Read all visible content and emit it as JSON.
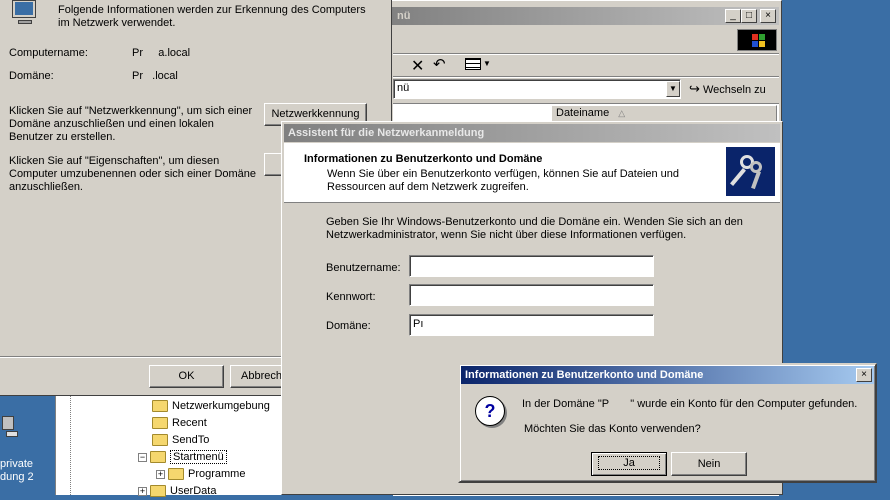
{
  "system_props": {
    "intro": "Folgende Informationen werden zur Erkennung des Computers im Netzwerk verwendet.",
    "computer_label": "Computername:",
    "computer_value": "Pr     a.local",
    "domain_label": "Domäne:",
    "domain_value": "Pr   .local",
    "network_id_text": "Klicken Sie auf \"Netzwerkkennung\", um sich einer Domäne anzuschließen und einen lokalen Benutzer zu erstellen.",
    "network_id_button": "Netzwerkkennung",
    "properties_text": "Klicken Sie auf \"Eigenschaften\", um diesen Computer umzubenennen oder sich einer Domäne anzuschließen.",
    "ok_button": "OK",
    "cancel_button": "Abbrech"
  },
  "explorer": {
    "title": "nü",
    "address_value": "nü",
    "go_button": "Wechseln zu",
    "column_filename": "Dateiname",
    "tree_items": [
      {
        "label": "Netzwerkumgebung",
        "expander": ""
      },
      {
        "label": "Recent",
        "expander": ""
      },
      {
        "label": "SendTo",
        "expander": ""
      },
      {
        "label": "Startmenü",
        "expander": "−"
      },
      {
        "label": "Programme",
        "expander": "+"
      },
      {
        "label": "UserData",
        "expander": "+"
      }
    ]
  },
  "desktop": {
    "icon_label_line1": "private",
    "icon_label_line2": "dung 2"
  },
  "wizard": {
    "title": "Assistent für die Netzwerkanmeldung",
    "header_title": "Informationen zu Benutzerkonto und Domäne",
    "header_desc": "Wenn Sie über ein Benutzerkonto verfügen, können Sie auf Dateien und Ressourcen auf dem Netzwerk zugreifen.",
    "instructions": "Geben Sie Ihr Windows-Benutzerkonto und die Domäne ein. Wenden Sie sich an den Netzwerkadministrator, wenn Sie nicht über diese Informationen verfügen.",
    "username_label": "Benutzername:",
    "username_value": "",
    "password_label": "Kennwort:",
    "password_value": "",
    "domain_label": "Domäne:",
    "domain_value": "Pı"
  },
  "msgbox": {
    "title": "Informationen zu Benutzerkonto und Domäne",
    "line1": "In der Domäne \"P       \" wurde ein Konto für den Computer gefunden.",
    "line2": "Möchten Sie das Konto verwenden?",
    "yes_button": "Ja",
    "no_button": "Nein"
  },
  "colors": {
    "desktop": "#3a6ea5",
    "title_active": "#0a246a",
    "face": "#d4d0c8"
  }
}
